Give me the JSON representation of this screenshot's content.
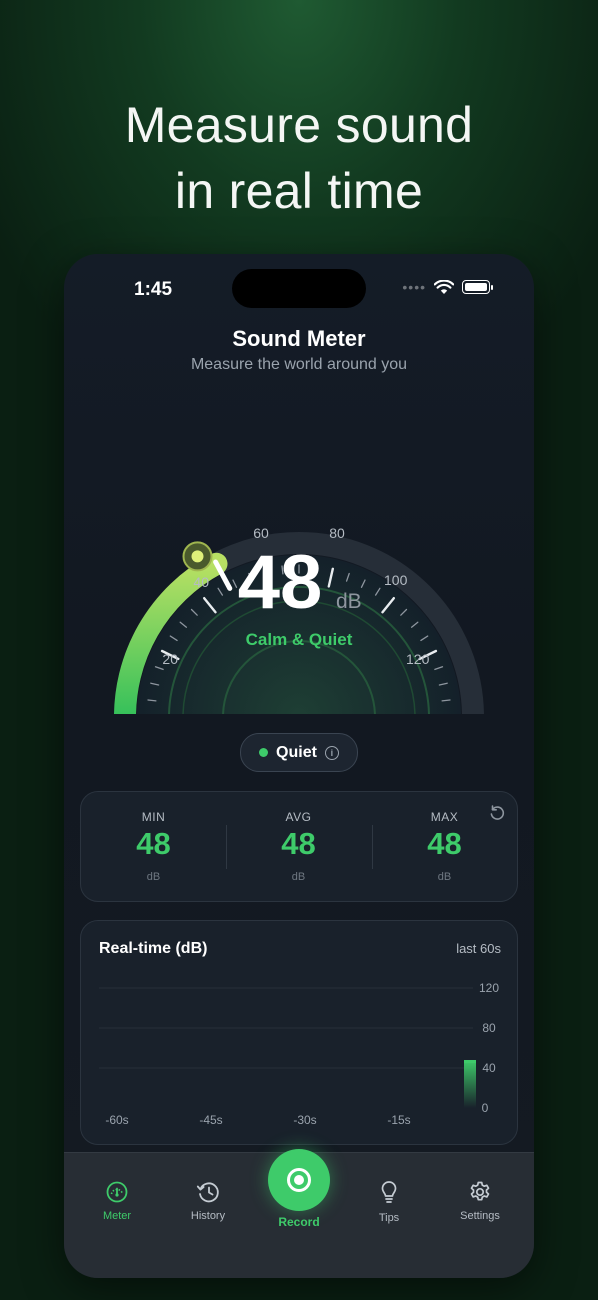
{
  "headline": {
    "line1": "Measure sound",
    "line2": "in real time"
  },
  "status": {
    "time": "1:45"
  },
  "app": {
    "title": "Sound Meter",
    "subtitle": "Measure the world around you"
  },
  "gauge": {
    "value": "48",
    "unit": "dB",
    "label": "Calm & Quiet",
    "level_db": 48,
    "scale_min_db": 0,
    "scale_max_db": 140,
    "tick_labels": [
      "20",
      "40",
      "60",
      "80",
      "100",
      "120"
    ],
    "accent": "#3ecb6a"
  },
  "status_pill": {
    "label": "Quiet",
    "info_icon": "info-icon"
  },
  "stats": {
    "min": {
      "label": "MIN",
      "value": "48",
      "unit": "dB"
    },
    "avg": {
      "label": "AVG",
      "value": "48",
      "unit": "dB"
    },
    "max": {
      "label": "MAX",
      "value": "48",
      "unit": "dB"
    }
  },
  "realtime": {
    "title": "Real-time (dB)",
    "range": "last 60s",
    "y_labels": [
      "120",
      "80",
      "40",
      "0"
    ],
    "x_labels": [
      "-60s",
      "-45s",
      "-30s",
      "-15s"
    ]
  },
  "chart_data": {
    "type": "bar",
    "title": "Real-time (dB)",
    "x_labels": [
      "-60s",
      "-45s",
      "-30s",
      "-15s"
    ],
    "ylim": [
      0,
      120
    ],
    "y_ticks": [
      0,
      40,
      80,
      120
    ],
    "x": [
      0
    ],
    "values": [
      48
    ]
  },
  "tabs": [
    {
      "label": "Meter",
      "icon": "gauge-icon",
      "active": true
    },
    {
      "label": "History",
      "icon": "history-icon",
      "active": false
    },
    {
      "label": "Record",
      "icon": "record-icon",
      "active": true
    },
    {
      "label": "Tips",
      "icon": "lightbulb-icon",
      "active": false
    },
    {
      "label": "Settings",
      "icon": "gear-icon",
      "active": false
    }
  ],
  "colors": {
    "accent": "#3ecb6a",
    "background": "#121821"
  }
}
